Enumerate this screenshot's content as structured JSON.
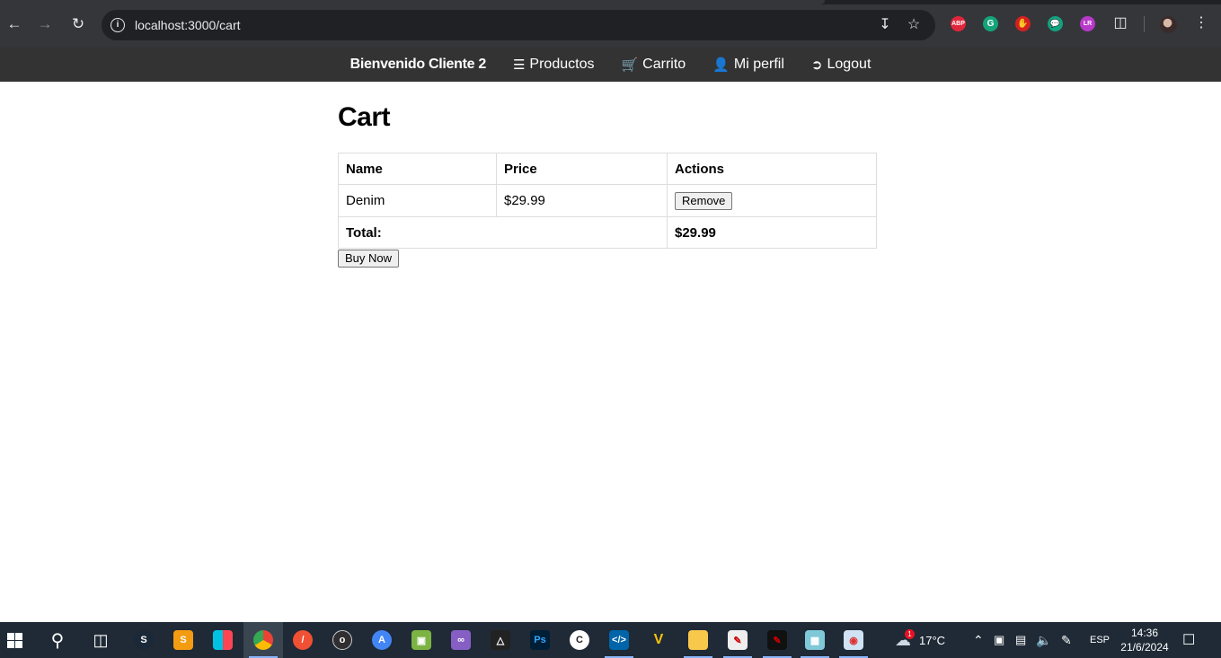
{
  "browser": {
    "url": "localhost:3000/cart",
    "extensions": [
      "ABP",
      "G",
      "✋",
      "💬",
      "LR"
    ]
  },
  "navbar": {
    "brand": "Bienvenido Cliente 2",
    "items": [
      {
        "icon": "list-icon",
        "label": "Productos"
      },
      {
        "icon": "cart-icon",
        "label": "Carrito"
      },
      {
        "icon": "user-icon",
        "label": "Mi perfil"
      },
      {
        "icon": "logout-icon",
        "label": "Logout"
      }
    ]
  },
  "page": {
    "title": "Cart",
    "table": {
      "headers": [
        "Name",
        "Price",
        "Actions"
      ],
      "rows": [
        {
          "name": "Denim",
          "price": "$29.99",
          "action": "Remove"
        }
      ],
      "total_label": "Total:",
      "total_value": "$29.99"
    },
    "buy_button": "Buy Now"
  },
  "taskbar": {
    "weather_badge": "1",
    "weather_temp": "17°C",
    "language": "ESP",
    "time": "14:36",
    "date": "21/6/2024",
    "apps": [
      "start",
      "search",
      "task-view",
      "steam",
      "sublime",
      "switch",
      "chrome",
      "git",
      "obs",
      "android-studio",
      "box3d",
      "visual-studio",
      "unity",
      "photoshop",
      "clip",
      "vscode",
      "vegas",
      "file-explorer",
      "app1",
      "app2",
      "app3",
      "paint"
    ]
  }
}
